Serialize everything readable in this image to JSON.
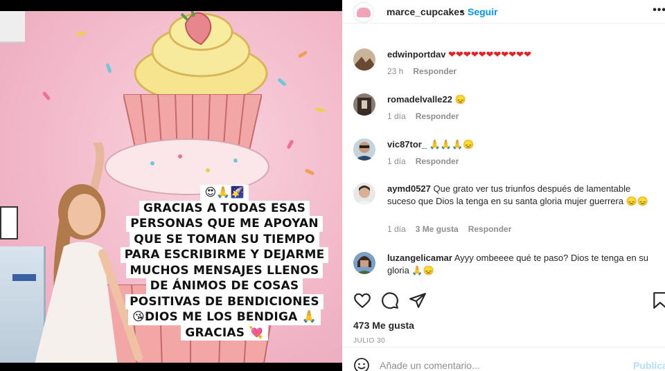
{
  "post": {
    "username": "marce_cupcakes",
    "separator": "•",
    "follow_label": "Seguir",
    "more_label": "•••"
  },
  "media": {
    "overlay_emojis_top": "😍🙏🌠",
    "overlay_lines": [
      "GRACIAS A TODAS ESAS",
      "PERSONAS QUE ME APOYAN",
      "QUE SE TOMAN SU TIEMPO",
      "PARA ESCRIBIRME Y DEJARME",
      "MUCHOS MENSAJES LLENOS",
      "DE ÁNIMOS DE COSAS",
      "POSITIVAS DE BENDICIONES",
      "DIOS ME LOS BENDIGA",
      "GRACIAS"
    ],
    "emoji_kiss": "😘",
    "emoji_pray": "🙏",
    "emoji_heart": "💘"
  },
  "comments": [
    {
      "user": "edwinportdav",
      "text": "❤❤❤❤❤❤❤❤❤❤❤",
      "time": "23 h",
      "reply": "Responder"
    },
    {
      "user": "romadelvalle22",
      "text": "😞",
      "time": "1 día",
      "reply": "Responder"
    },
    {
      "user": "vic87tor_",
      "text": "🙏🙏🙏😞",
      "time": "1 día",
      "reply": "Responder"
    },
    {
      "user": "aymd0527",
      "text": "Que grato ver tus triunfos después de lamentable suceso que Dios la tenga en su santa gloria mujer guerrera 😞😞",
      "time": "1 día",
      "likes": "3 Me gusta",
      "reply": "Responder"
    },
    {
      "user": "luzangelicamar",
      "text": "Ayyy ombeeee qué te paso? Dios te tenga en su gloria 🙏😞"
    }
  ],
  "likes_count": "473 Me gusta",
  "date": "JULIO 30",
  "comment_box": {
    "placeholder": "Añade un comentario...",
    "publish_label": "Publicar"
  },
  "icons": [
    "heart-icon",
    "comment-icon",
    "share-icon",
    "bookmark-icon",
    "smiley-icon",
    "more-icon"
  ],
  "colors": {
    "link_blue": "#0095f6",
    "publish_disabled": "#b2dffc",
    "muted": "#8e8e8e",
    "heart_red": "#ed1c24"
  }
}
